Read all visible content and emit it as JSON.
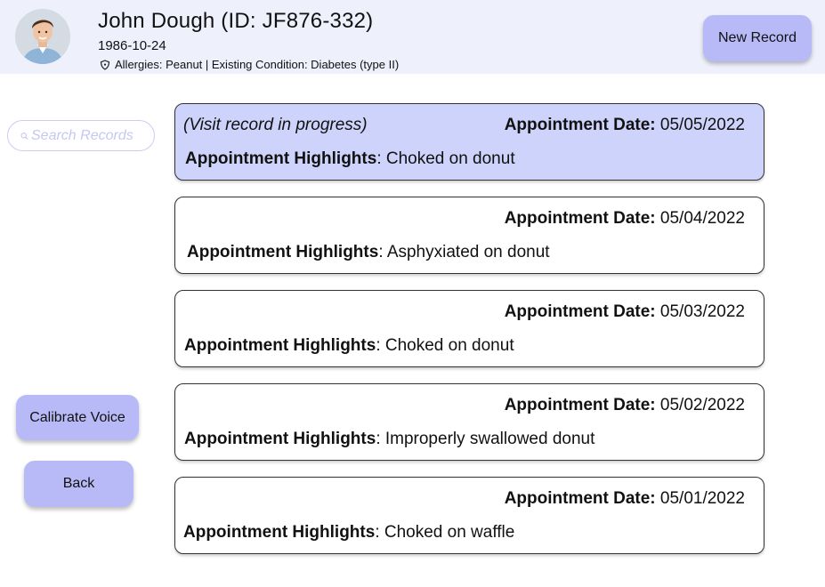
{
  "patient": {
    "name": "John Dough (ID: JF876-332)",
    "dob": "1986-10-24",
    "info": "Allergies: Peanut | Existing Condition: Diabetes (type II)",
    "info_icon": "shield-icon",
    "avatar": "patient-photo"
  },
  "actions": {
    "new_record": "New Record",
    "calibrate_voice": "Calibrate Voice",
    "back": "Back"
  },
  "search": {
    "placeholder": "Search Records",
    "icon": "search-icon"
  },
  "colors": {
    "header_bg": "#eef0fc",
    "button_bg": "#b8baf8",
    "active_card_bg": "#cdd3fb",
    "search_border": "#c8ccf6"
  },
  "record_labels": {
    "date": "Appointment Date:",
    "highlights": "Appointment Highlights"
  },
  "records": [
    {
      "status": "(Visit record in progress)",
      "date": "05/05/2022",
      "highlights": ": Choked on donut",
      "active": true
    },
    {
      "status": "",
      "date": "05/04/2022",
      "highlights": ": Asphyxiated on donut",
      "active": false
    },
    {
      "status": "",
      "date": "05/03/2022",
      "highlights": ": Choked on donut",
      "active": false
    },
    {
      "status": "",
      "date": "05/02/2022",
      "highlights": ": Improperly swallowed donut",
      "active": false
    },
    {
      "status": "",
      "date": "05/01/2022",
      "highlights": ": Choked on waffle",
      "active": false
    }
  ]
}
